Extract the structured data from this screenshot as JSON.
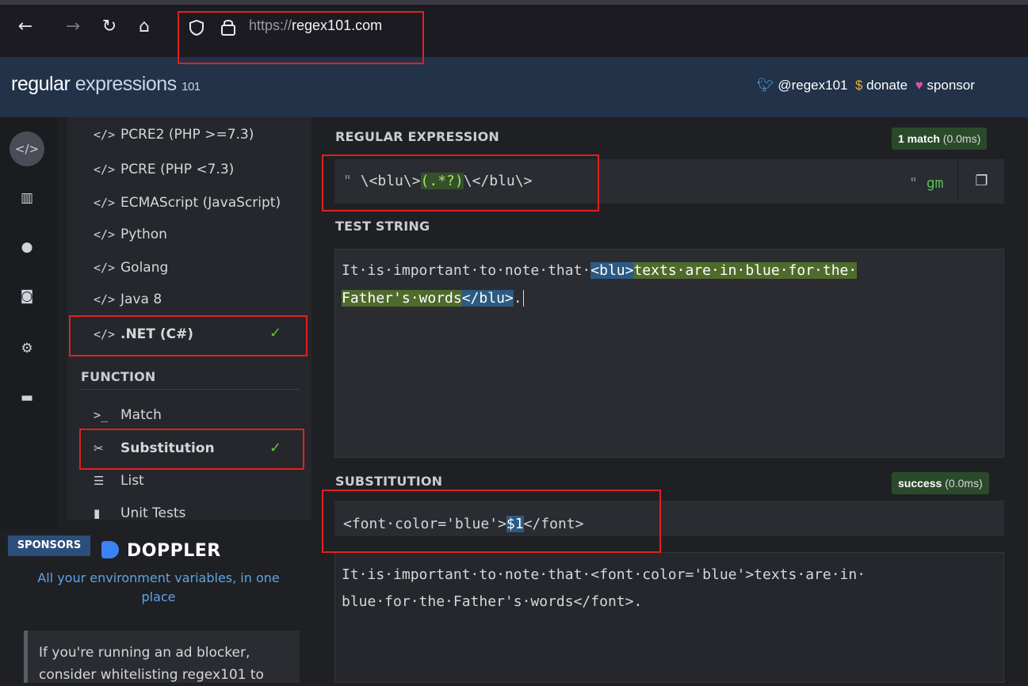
{
  "browser": {
    "url_prefix": "https://",
    "url_domain": "regex101.com",
    "back_glyph": "←",
    "forward_glyph": "→",
    "reload_glyph": "↻",
    "home_glyph": "⌂"
  },
  "header": {
    "logo_bold": "regular",
    "logo_light": " expressions ",
    "logo_sub": "101",
    "twitter_label": "@regex101",
    "donate_label": "donate",
    "sponsor_label": "sponsor"
  },
  "rail": {
    "icons": [
      "code-icon",
      "library-icon",
      "account-icon",
      "quiz-icon",
      "settings-icon",
      "chat-icon"
    ]
  },
  "flavors": {
    "items": [
      {
        "label": "PCRE2 (PHP >=7.3)"
      },
      {
        "label": "PCRE (PHP <7.3)"
      },
      {
        "label": "ECMAScript (JavaScript)"
      },
      {
        "label": "Python"
      },
      {
        "label": "Golang"
      },
      {
        "label": "Java 8"
      },
      {
        "label": ".NET (C#)",
        "selected": true
      }
    ],
    "item_icon": "</>"
  },
  "function": {
    "heading": "FUNCTION",
    "items": [
      {
        "icon": ">_",
        "label": "Match"
      },
      {
        "icon": "✂",
        "label": "Substitution",
        "selected": true
      },
      {
        "icon": "☰",
        "label": "List"
      },
      {
        "icon": "▮",
        "label": "Unit Tests"
      }
    ]
  },
  "sponsors": {
    "tag": "SPONSORS",
    "brand": "DOPPLER",
    "tagline": "All your environment variables, in one place",
    "adblock_text": "If you're running an ad blocker, consider whitelisting regex101 to"
  },
  "regex": {
    "label": "REGULAR EXPRESSION",
    "match_count": "1 match",
    "match_time": " (0.0ms)",
    "delimiter_open": "\"",
    "delimiter_close": "\"",
    "flags": "gm",
    "parts": [
      "\\<blu\\>",
      "(.*?)",
      "\\</blu\\>"
    ]
  },
  "test_string": {
    "label": "TEST STRING",
    "line1_pre": "It·is·important·to·note·that·",
    "line1_tag": "<blu>",
    "line1_match": "texts·are·in·blue·for·the·",
    "line2_match": "Father's·words",
    "line2_tag": "</blu>",
    "line2_post": "."
  },
  "substitution": {
    "label": "SUBSTITUTION",
    "status": "success",
    "status_time": " (0.0ms)",
    "pre": "<font·color='blue'>",
    "var": "$1",
    "post": "</font>",
    "result_line1": "It·is·important·to·note·that·<font·color='blue'>texts·are·in·",
    "result_line2": "blue·for·the·Father's·words</font>."
  },
  "colors": {
    "header_bg": "#213249",
    "match_green": "#4e6b2c",
    "match_blue": "#2c5a82",
    "check_green": "#67c23a",
    "annotation_red": "#e02020"
  }
}
